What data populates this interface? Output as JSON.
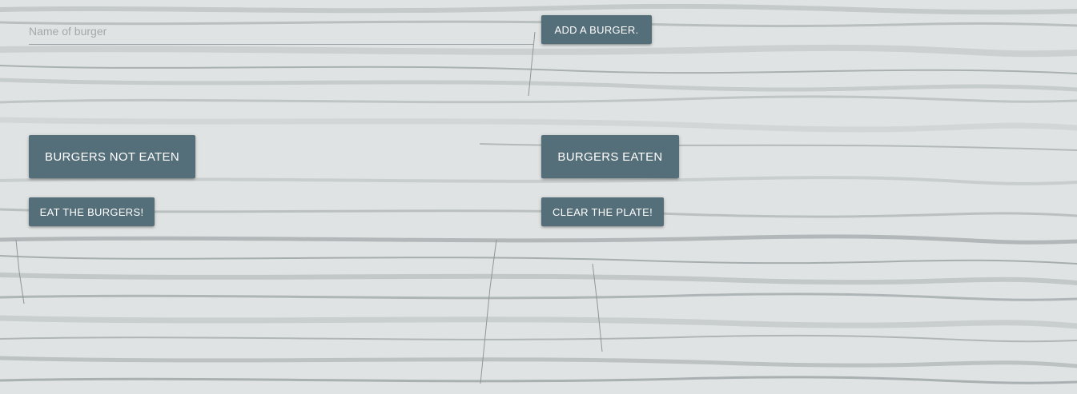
{
  "form": {
    "burger_name_value": "",
    "burger_name_placeholder": "Name of burger",
    "add_label": "ADD A BURGER."
  },
  "columns": {
    "not_eaten_heading": "BURGERS NOT EATEN",
    "eaten_heading": "BURGERS EATEN",
    "eat_label": "EAT THE BURGERS!",
    "clear_label": "CLEAR THE PLATE!"
  },
  "colors": {
    "button": "#546e7a",
    "button_text": "#ffffff",
    "background": "#dfe2e2",
    "input_underline": "#9aa1a4",
    "placeholder": "#a3a8aa"
  }
}
